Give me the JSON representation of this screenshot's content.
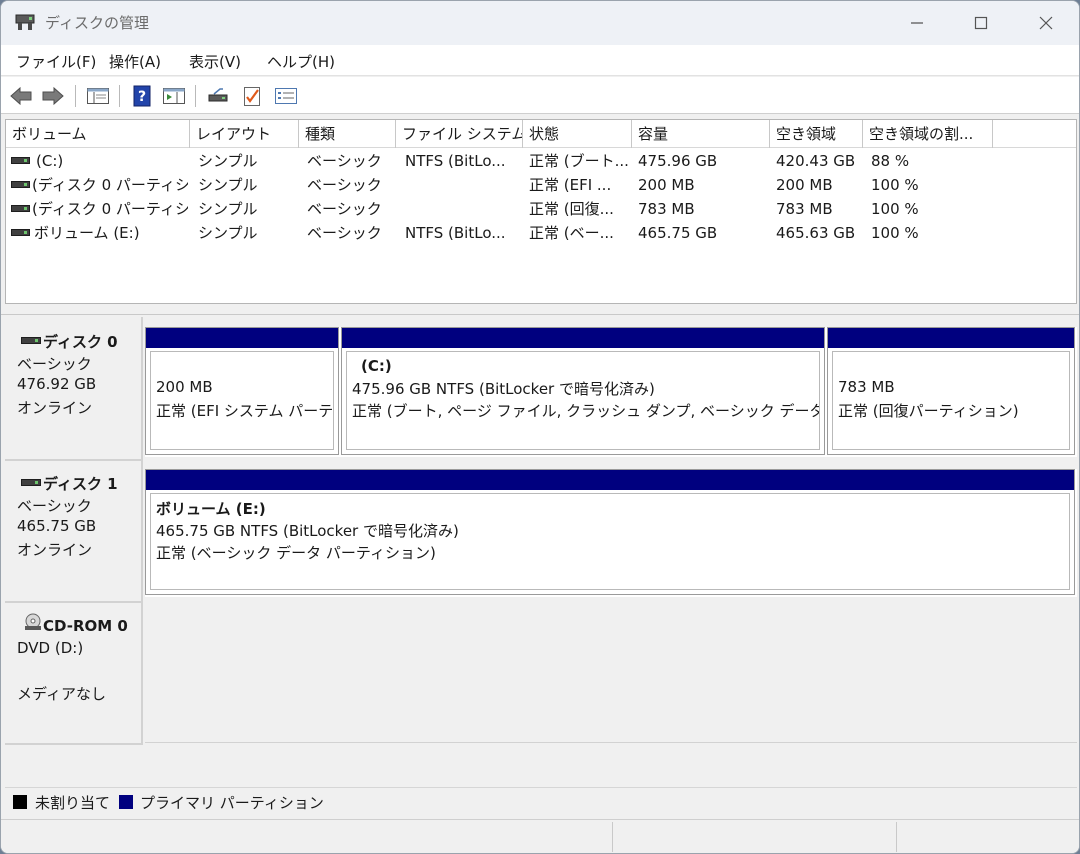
{
  "window": {
    "title": "ディスクの管理"
  },
  "menu": [
    "ファイル(F)",
    "操作(A)",
    "表示(V)",
    "ヘルプ(H)"
  ],
  "toolbar": {
    "icons": [
      "back-arrow-icon",
      "forward-arrow-icon",
      "console-tree-icon",
      "help-icon",
      "action-pane-icon",
      "connect-drive-icon",
      "checklist-icon",
      "properties-icon"
    ]
  },
  "volume_list": {
    "columns": [
      "ボリューム",
      "レイアウト",
      "種類",
      "ファイル システム",
      "状態",
      "容量",
      "空き領域",
      "空き領域の割..."
    ],
    "rows": [
      [
        "(C:)",
        "シンプル",
        "ベーシック",
        "NTFS (BitLo...",
        "正常 (ブート...",
        "475.96 GB",
        "420.43 GB",
        "88 %"
      ],
      [
        "(ディスク 0 パーティシ...",
        "シンプル",
        "ベーシック",
        "",
        "正常 (EFI ...",
        "200 MB",
        "200 MB",
        "100 %"
      ],
      [
        "(ディスク 0 パーティシ...",
        "シンプル",
        "ベーシック",
        "",
        "正常 (回復...",
        "783 MB",
        "783 MB",
        "100 %"
      ],
      [
        "ボリューム (E:)",
        "シンプル",
        "ベーシック",
        "NTFS (BitLo...",
        "正常 (ベー...",
        "465.75 GB",
        "465.63 GB",
        "100 %"
      ]
    ]
  },
  "disks": {
    "disk0": {
      "name": "ディスク 0",
      "type": "ベーシック",
      "size": "476.92 GB",
      "status": "オンライン",
      "partitions": [
        {
          "name": "",
          "line1": "200 MB",
          "line2": "正常 (EFI システム パーティ"
        },
        {
          "name": "(C:)",
          "line1": "475.96 GB NTFS (BitLocker で暗号化済み)",
          "line2": "正常 (ブート, ページ ファイル, クラッシュ ダンプ, ベーシック データ パーティ"
        },
        {
          "name": "",
          "line1": "783 MB",
          "line2": "正常 (回復パーティション)"
        }
      ]
    },
    "disk1": {
      "name": "ディスク 1",
      "type": "ベーシック",
      "size": "465.75 GB",
      "status": "オンライン",
      "partitions": [
        {
          "name": "ボリューム  (E:)",
          "line1": "465.75 GB NTFS (BitLocker で暗号化済み)",
          "line2": "正常 (ベーシック データ パーティション)"
        }
      ]
    },
    "cdrom0": {
      "name": "CD-ROM 0",
      "type": "DVD (D:)",
      "status": "メディアなし"
    }
  },
  "legend": [
    {
      "label": "未割り当て",
      "color": "#000000"
    },
    {
      "label": "プライマリ パーティション",
      "color": "#00007f"
    }
  ]
}
